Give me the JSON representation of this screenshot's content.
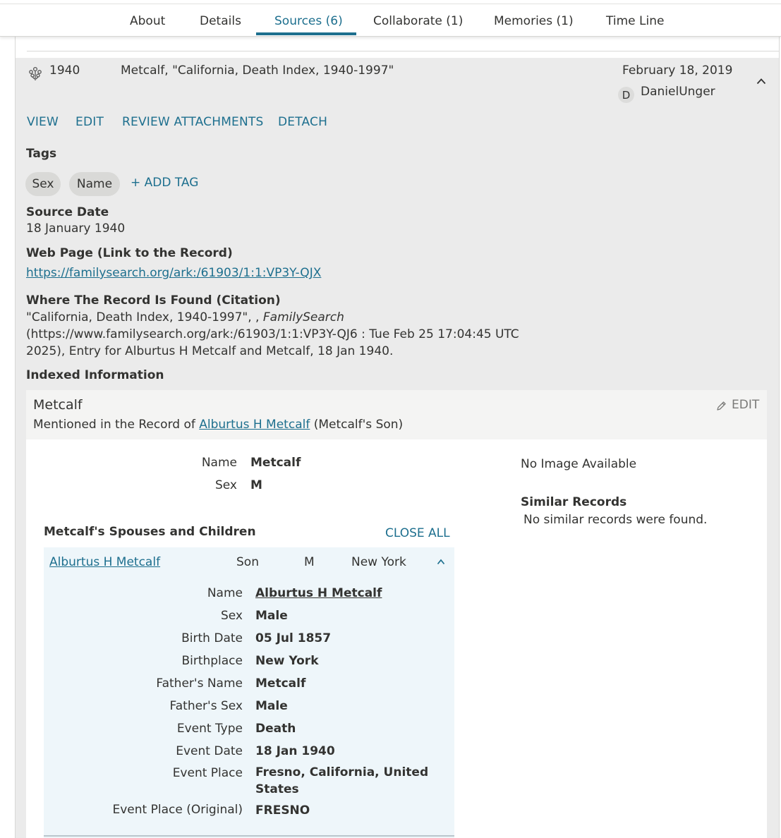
{
  "tabs": [
    {
      "label": "About"
    },
    {
      "label": "Details"
    },
    {
      "label": "Sources (6)"
    },
    {
      "label": "Collaborate (1)"
    },
    {
      "label": "Memories (1)"
    },
    {
      "label": "Time Line"
    }
  ],
  "active_tab": "Sources (6)",
  "source": {
    "year": "1940",
    "title": "Metcalf, \"California, Death Index, 1940-1997\"",
    "attached_date": "February 18, 2019",
    "attached_by_initial": "D",
    "attached_by": "DanielUnger",
    "icon": "tree-icon",
    "actions": {
      "view": "VIEW",
      "edit": "EDIT",
      "review": "REVIEW ATTACHMENTS",
      "detach": "DETACH"
    },
    "tags_label": "Tags",
    "tags": [
      "Sex",
      "Name"
    ],
    "add_tag": "+ ADD TAG",
    "source_date_label": "Source Date",
    "source_date": "18 January 1940",
    "web_page_label": "Web Page (Link to the Record)",
    "web_page_url": "https://familysearch.org/ark:/61903/1:1:VP3Y-QJX",
    "citation_label": "Where The Record Is Found (Citation)",
    "citation_line1_a": "\"California, Death Index, 1940-1997\", ,",
    "citation_line1_b": "FamilySearch",
    "citation_line2": "(https://www.familysearch.org/ark:/61903/1:1:VP3Y-QJ6 : Tue Feb 25 17:04:45 UTC",
    "citation_line3": "2025), Entry for Alburtus H Metcalf and Metcalf, 18 Jan 1940.",
    "indexed_label": "Indexed Information"
  },
  "indexed": {
    "person_name": "Metcalf",
    "edit_label": "EDIT",
    "mentioned_prefix": "Mentioned in the Record of",
    "mentioned_link": "Alburtus H Metcalf",
    "mentioned_suffix": "(Metcalf's Son)",
    "fields": [
      {
        "label": "Name",
        "value": "Metcalf"
      },
      {
        "label": "Sex",
        "value": "M"
      }
    ],
    "no_image": "No Image Available",
    "similar_label": "Similar Records",
    "similar_text": "No similar records were found.",
    "spouses_label": "Metcalf's Spouses and Children",
    "close_all": "CLOSE ALL",
    "child": {
      "name": "Alburtus H Metcalf",
      "relation": "Son",
      "sex": "M",
      "place": "New York",
      "details": [
        {
          "label": "Name",
          "value": "Alburtus H Metcalf"
        },
        {
          "label": "Sex",
          "value": "Male"
        },
        {
          "label": "Birth Date",
          "value": "05 Jul 1857"
        },
        {
          "label": "Birthplace",
          "value": "New York"
        },
        {
          "label": "Father's Name",
          "value": "Metcalf"
        },
        {
          "label": "Father's Sex",
          "value": "Male"
        },
        {
          "label": "Event Type",
          "value": "Death"
        },
        {
          "label": "Event Date",
          "value": "18 Jan 1940"
        },
        {
          "label": "Event Place",
          "value": "Fresno, California, United"
        },
        {
          "label": "Event Place (Original)",
          "value": "FRESNO"
        }
      ],
      "event_place_cont": "States"
    }
  },
  "colors": {
    "accent": "#1d6f8e",
    "card_bg": "#ebebeb",
    "panel_bg": "#eef6fa"
  }
}
